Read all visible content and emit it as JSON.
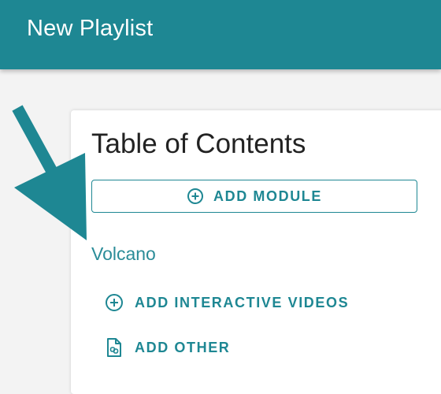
{
  "header": {
    "title": "New Playlist"
  },
  "toc": {
    "title": "Table of Contents",
    "add_module_label": "ADD MODULE",
    "module": {
      "name": "Volcano",
      "actions": [
        {
          "label": "ADD INTERACTIVE VIDEOS",
          "icon": "plus-circle-icon"
        },
        {
          "label": "ADD OTHER",
          "icon": "document-link-icon"
        }
      ]
    }
  },
  "colors": {
    "accent": "#1e8793",
    "background": "#f3f3f3",
    "card": "#ffffff"
  }
}
